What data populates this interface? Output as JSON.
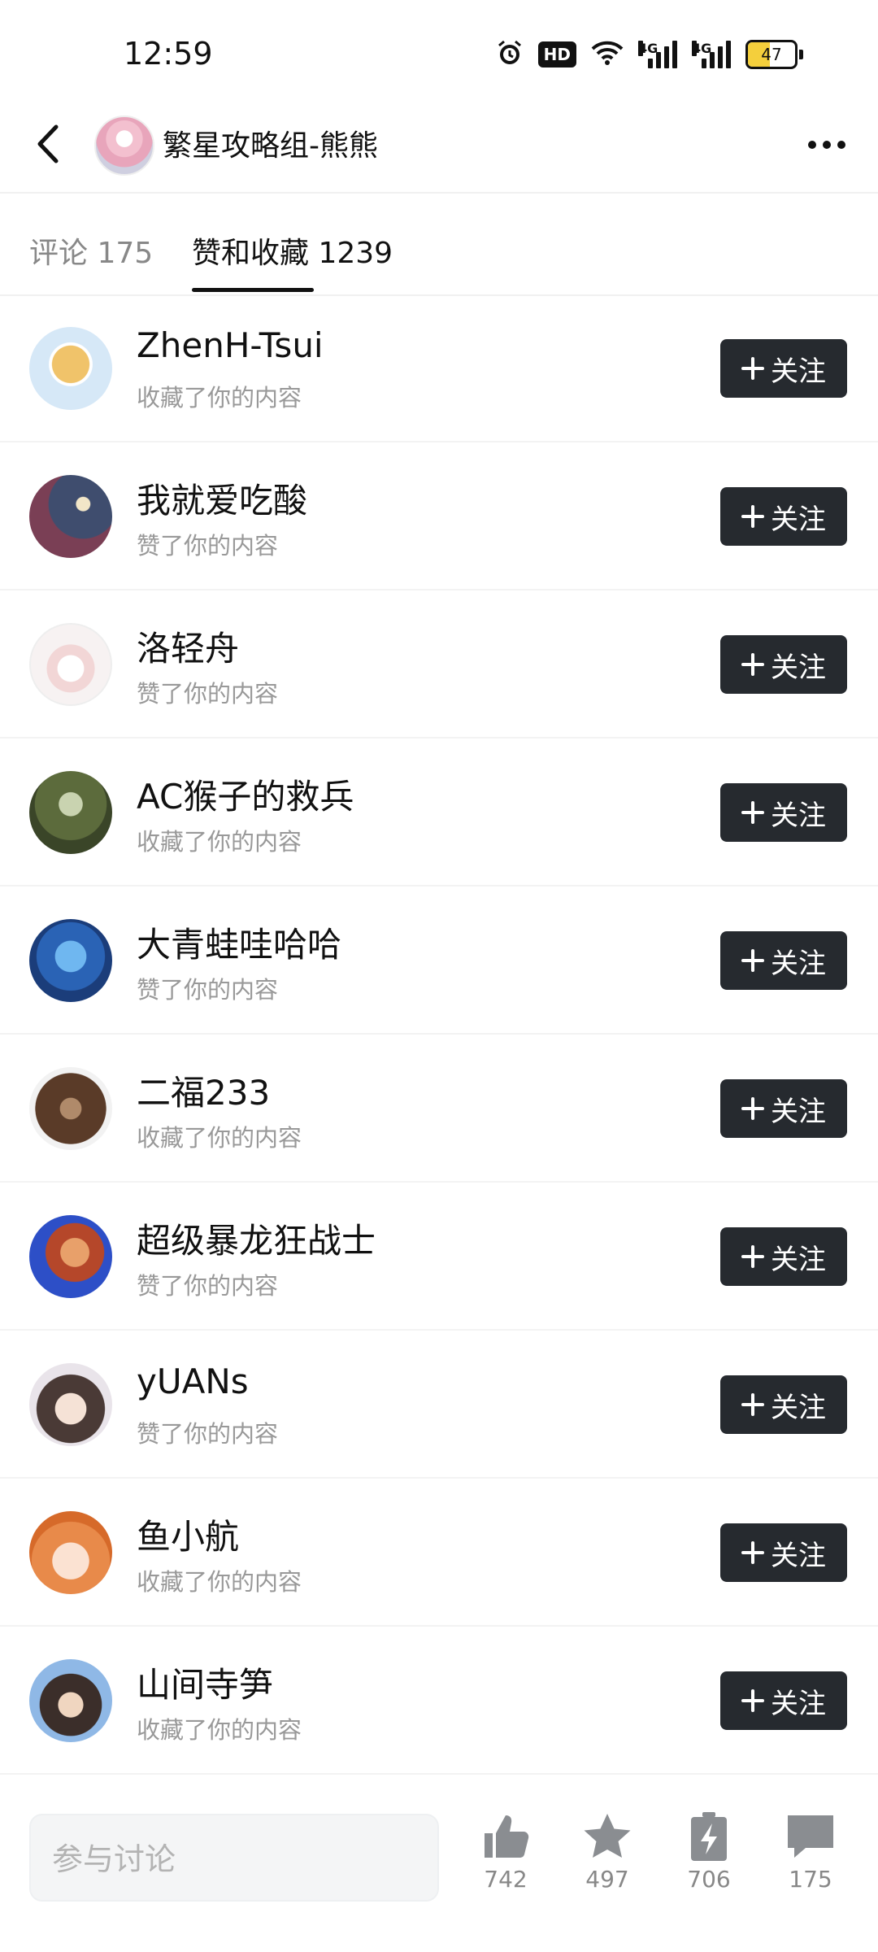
{
  "status": {
    "time": "12:59",
    "hd": "HD",
    "net1": "4G",
    "net2": "4G",
    "battery": "47"
  },
  "header": {
    "title": "繁星攻略组-熊熊"
  },
  "tabs": {
    "comments": "评论 175",
    "likes": "赞和收藏 1239"
  },
  "follow_label": "关注",
  "rows": [
    {
      "name": "ZhenH-Tsui",
      "action": "收藏了你的内容"
    },
    {
      "name": "我就爱吃酸",
      "action": "赞了你的内容"
    },
    {
      "name": "洛轻舟",
      "action": "赞了你的内容"
    },
    {
      "name": "AC猴子的救兵",
      "action": "收藏了你的内容"
    },
    {
      "name": "大青蛙哇哈哈",
      "action": "赞了你的内容"
    },
    {
      "name": "二福233",
      "action": "收藏了你的内容"
    },
    {
      "name": "超级暴龙狂战士",
      "action": "赞了你的内容"
    },
    {
      "name": "yUANs",
      "action": "赞了你的内容"
    },
    {
      "name": "鱼小航",
      "action": "收藏了你的内容"
    },
    {
      "name": "山间寺笋",
      "action": "收藏了你的内容"
    }
  ],
  "bottom": {
    "input_placeholder": "参与讨论",
    "likes": "742",
    "favorites": "497",
    "charges": "706",
    "comments": "175"
  },
  "colors": {
    "follow_button": "#262a2f",
    "battery_fill": "#f4cf3c"
  }
}
